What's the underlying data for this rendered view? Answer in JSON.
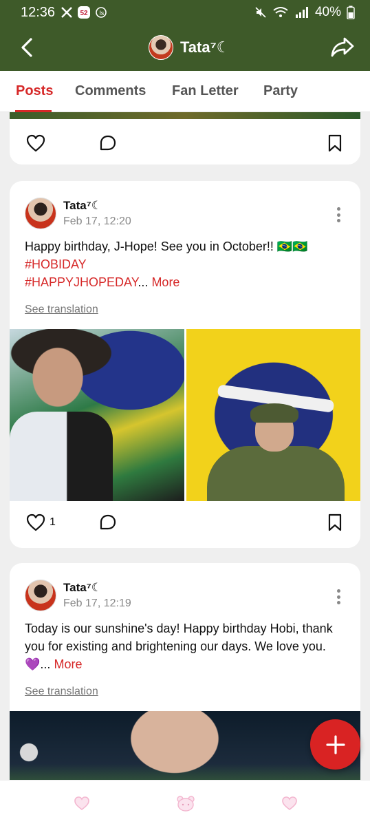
{
  "status_bar": {
    "time": "12:36",
    "battery": "40%",
    "left_icons": [
      "x-logo-icon",
      "notification-icon",
      "app-icon"
    ],
    "right_icons": [
      "mute-icon",
      "wifi-icon",
      "signal-icon",
      "battery-icon"
    ]
  },
  "app_bar": {
    "title": "Tata⁷☾",
    "background": "#3e5a29"
  },
  "tabs": [
    {
      "label": "Posts",
      "active": true
    },
    {
      "label": "Comments",
      "active": false
    },
    {
      "label": "Fan Letter",
      "active": false
    },
    {
      "label": "Party",
      "active": false
    }
  ],
  "posts": [
    {
      "author": "Tata⁷☾",
      "date": "Feb 17, 12:20",
      "text": "Happy birthday, J-Hope! See you in October!! 🇧🇷🇧🇷",
      "tags": [
        "#HOBIDAY",
        "#HAPPYJHOPEDAY"
      ],
      "ellipsis": "...",
      "more_label": "More",
      "see_translation": "See translation",
      "likes": "1"
    },
    {
      "author": "Tata⁷☾",
      "date": "Feb 17, 12:19",
      "text": "Today is our sunshine's day! Happy birthday Hobi, thank you for existing and brightening our days. We love you. 💜",
      "ellipsis": "...",
      "more_label": "More",
      "see_translation": "See translation"
    }
  ],
  "accent_color": "#d62828"
}
